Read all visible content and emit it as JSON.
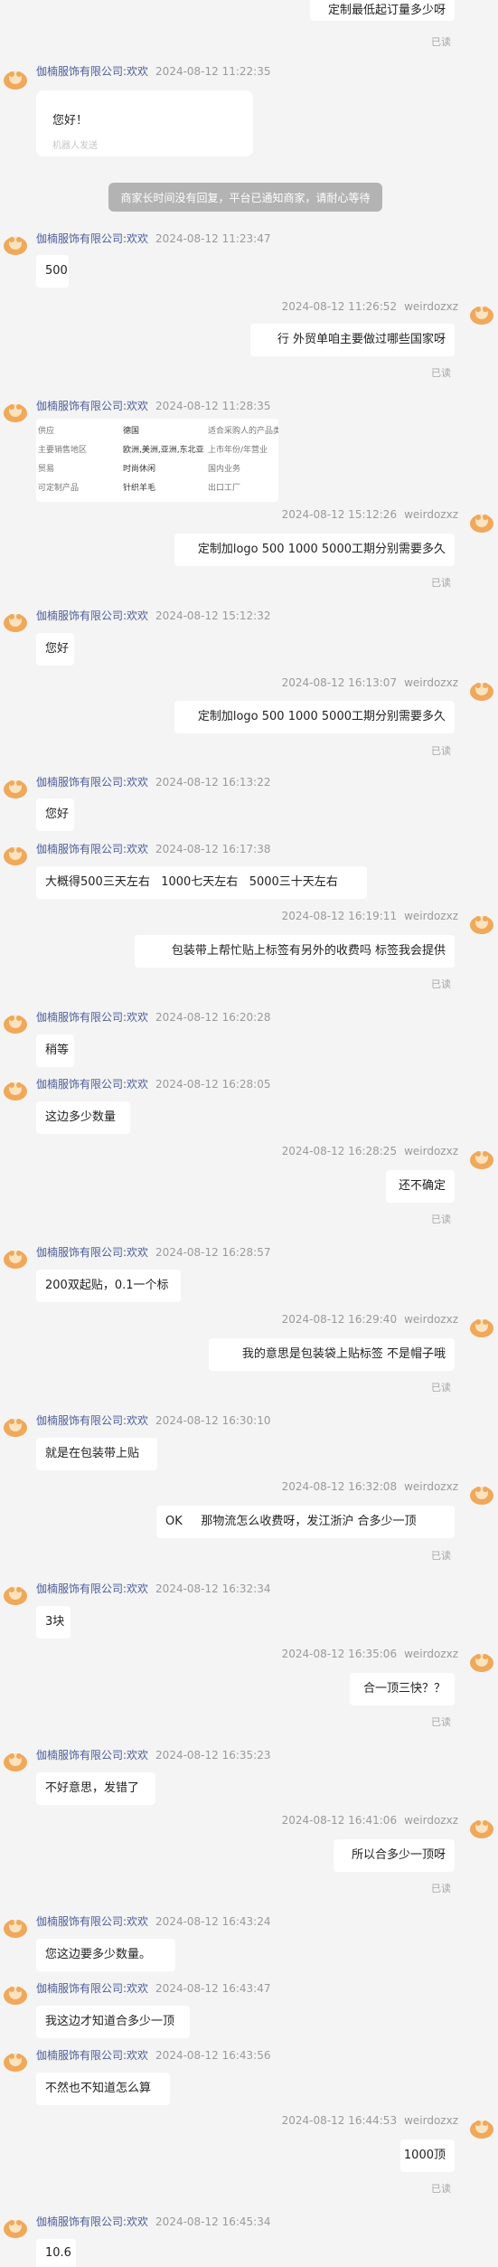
{
  "messages": [
    {
      "side": "right",
      "text": "定制最低起订量多少呀",
      "read": "已读",
      "no_header": true
    },
    {
      "side": "left",
      "seller": "伽楠服饰有限公司:欢欢",
      "time": "2024-08-12 11:22:35",
      "type": "greeting",
      "text": "您好！",
      "note": "机器人发送"
    },
    {
      "type": "system",
      "text": "商家长时间没有回复，平台已通知商家，请耐心等待"
    },
    {
      "side": "left",
      "seller": "伽楠服饰有限公司:欢欢",
      "time": "2024-08-12 11:23:47",
      "text": "500"
    },
    {
      "side": "right",
      "time": "2024-08-12 11:26:52",
      "user": "weirdozxz",
      "text": "行 外贸单咱主要做过哪些国家呀",
      "read": "已读"
    },
    {
      "side": "left",
      "seller": "伽楠服饰有限公司:欢欢",
      "time": "2024-08-12 11:28:35",
      "type": "card",
      "rows": [
        [
          "供应",
          "德国",
          "适合采购人的产品类型"
        ],
        [
          "主要销售地区",
          "欧洲,美洲,亚洲,东北亚",
          "上市年份/年营业"
        ],
        [
          "贸易",
          "时尚休闲",
          "国内业务"
        ],
        [
          "可定制产品",
          "针织羊毛",
          "出口工厂"
        ]
      ]
    },
    {
      "side": "right",
      "time": "2024-08-12 15:12:26",
      "user": "weirdozxz",
      "text": "定制加logo 500 1000 5000工期分别需要多久",
      "read": "已读"
    },
    {
      "side": "left",
      "seller": "伽楠服饰有限公司:欢欢",
      "time": "2024-08-12 15:12:32",
      "text": "您好"
    },
    {
      "side": "right",
      "time": "2024-08-12 16:13:07",
      "user": "weirdozxz",
      "text": "定制加logo 500 1000 5000工期分别需要多久",
      "read": "已读"
    },
    {
      "side": "left",
      "seller": "伽楠服饰有限公司:欢欢",
      "time": "2024-08-12 16:13:22",
      "text": "您好"
    },
    {
      "side": "left",
      "seller": "伽楠服饰有限公司:欢欢",
      "time": "2024-08-12 16:17:38",
      "text": "大概得500三天左右   1000七天左右   5000三十天左右"
    },
    {
      "side": "right",
      "time": "2024-08-12 16:19:11",
      "user": "weirdozxz",
      "text": "包装带上帮忙贴上标签有另外的收费吗 标签我会提供",
      "read": "已读"
    },
    {
      "side": "left",
      "seller": "伽楠服饰有限公司:欢欢",
      "time": "2024-08-12 16:20:28",
      "text": "稍等"
    },
    {
      "side": "left",
      "seller": "伽楠服饰有限公司:欢欢",
      "time": "2024-08-12 16:28:05",
      "text": "这边多少数量"
    },
    {
      "side": "right",
      "time": "2024-08-12 16:28:25",
      "user": "weirdozxz",
      "text": "还不确定",
      "read": "已读"
    },
    {
      "side": "left",
      "seller": "伽楠服饰有限公司:欢欢",
      "time": "2024-08-12 16:28:57",
      "text": "200双起贴，0.1一个标"
    },
    {
      "side": "right",
      "time": "2024-08-12 16:29:40",
      "user": "weirdozxz",
      "text": "我的意思是包装袋上贴标签 不是帽子哦",
      "read": "已读"
    },
    {
      "side": "left",
      "seller": "伽楠服饰有限公司:欢欢",
      "time": "2024-08-12 16:30:10",
      "text": "就是在包装带上贴"
    },
    {
      "side": "right",
      "time": "2024-08-12 16:32:08",
      "user": "weirdozxz",
      "text": "OK     那物流怎么收费呀，发江浙沪 合多少一顶",
      "read": "已读"
    },
    {
      "side": "left",
      "seller": "伽楠服饰有限公司:欢欢",
      "time": "2024-08-12 16:32:34",
      "text": "3块"
    },
    {
      "side": "right",
      "time": "2024-08-12 16:35:06",
      "user": "weirdozxz",
      "text": "合一顶三快？？",
      "read": "已读"
    },
    {
      "side": "left",
      "seller": "伽楠服饰有限公司:欢欢",
      "time": "2024-08-12 16:35:23",
      "text": "不好意思，发错了"
    },
    {
      "side": "right",
      "time": "2024-08-12 16:41:06",
      "user": "weirdozxz",
      "text": "所以合多少一顶呀",
      "read": "已读"
    },
    {
      "side": "left",
      "seller": "伽楠服饰有限公司:欢欢",
      "time": "2024-08-12 16:43:24",
      "text": "您这边要多少数量。"
    },
    {
      "side": "left",
      "seller": "伽楠服饰有限公司:欢欢",
      "time": "2024-08-12 16:43:47",
      "text": "我这边才知道合多少一顶"
    },
    {
      "side": "left",
      "seller": "伽楠服饰有限公司:欢欢",
      "time": "2024-08-12 16:43:56",
      "text": "不然也不知道怎么算"
    },
    {
      "side": "right",
      "time": "2024-08-12 16:44:53",
      "user": "weirdozxz",
      "text": "1000顶",
      "read": "已读"
    },
    {
      "side": "left",
      "seller": "伽楠服饰有限公司:欢欢",
      "time": "2024-08-12 16:45:34",
      "text": "10.6"
    }
  ]
}
